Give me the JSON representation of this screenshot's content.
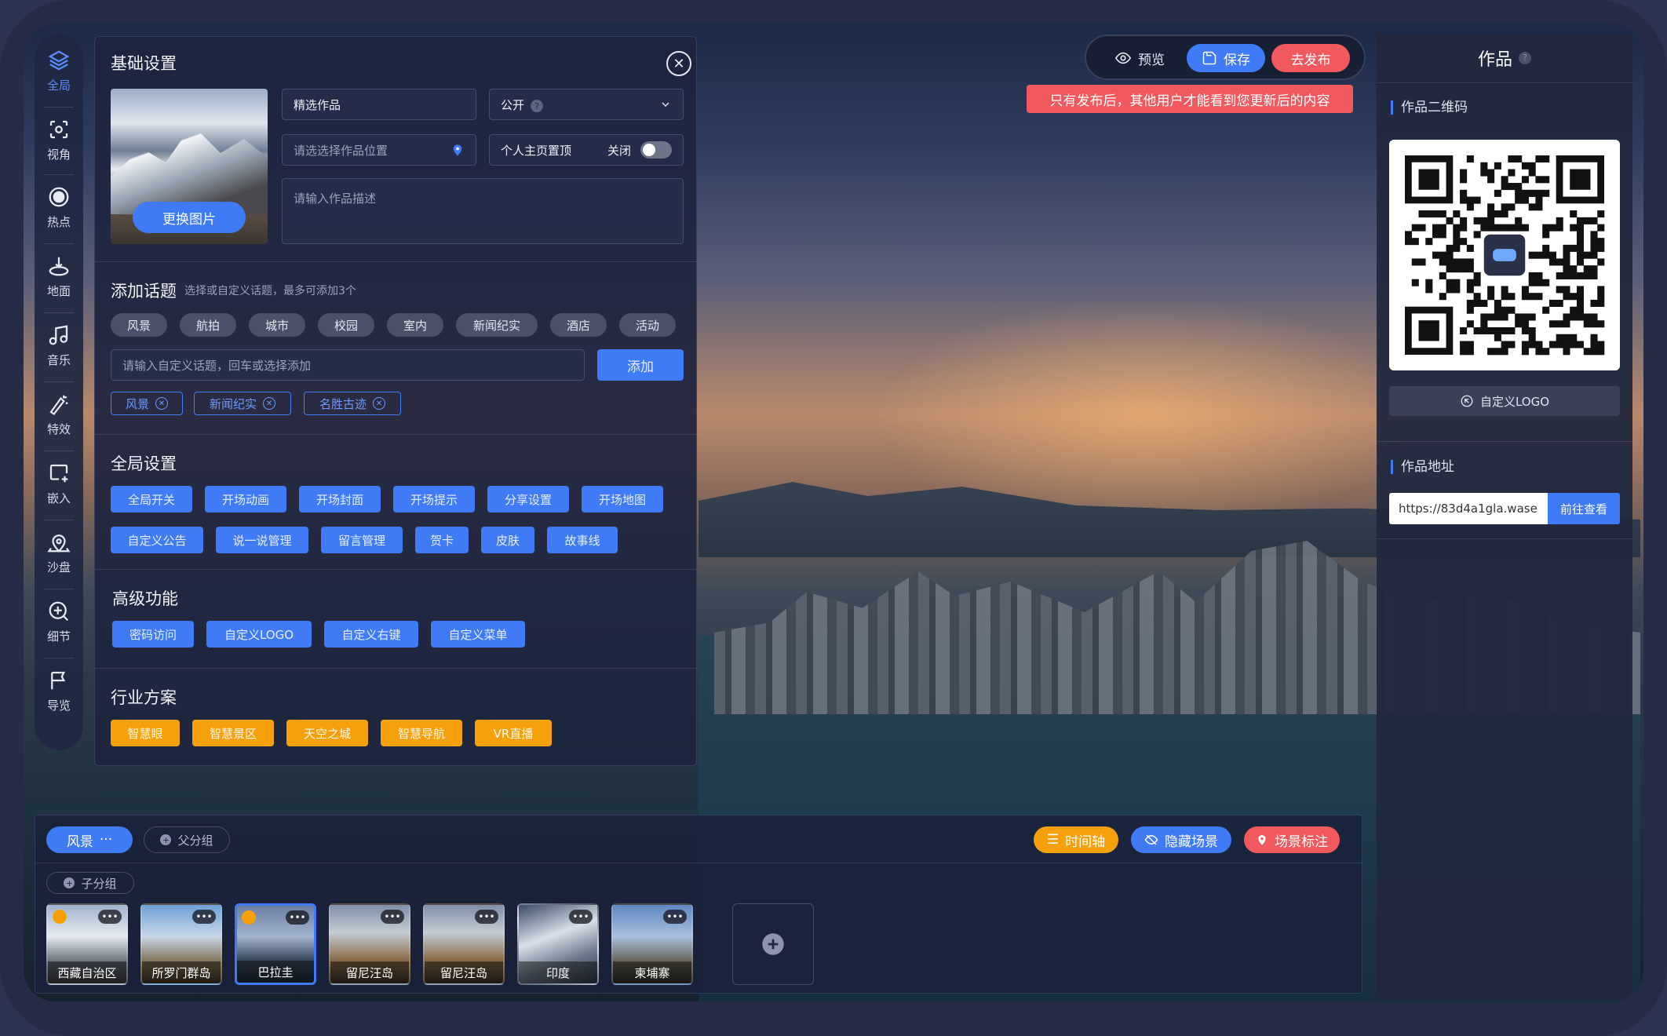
{
  "sidebar": {
    "items": [
      {
        "label": "全局",
        "icon": "layers-icon"
      },
      {
        "label": "视角",
        "icon": "view-angle-icon"
      },
      {
        "label": "热点",
        "icon": "hotspot-icon"
      },
      {
        "label": "地面",
        "icon": "ground-icon"
      },
      {
        "label": "音乐",
        "icon": "music-icon"
      },
      {
        "label": "特效",
        "icon": "effects-icon"
      },
      {
        "label": "嵌入",
        "icon": "embed-icon"
      },
      {
        "label": "沙盘",
        "icon": "sandbox-icon"
      },
      {
        "label": "细节",
        "icon": "zoom-detail-icon"
      },
      {
        "label": "导览",
        "icon": "tour-flag-icon"
      }
    ]
  },
  "basic": {
    "title": "基础设置",
    "change_image": "更换图片",
    "name_value": "精选作品",
    "visibility": "公开",
    "location_placeholder": "请选选择作品位置",
    "pin_label": "个人主页置顶",
    "pin_state": "关闭",
    "desc_placeholder": "请输入作品描述"
  },
  "topics": {
    "title": "添加话题",
    "hint": "选择或自定义话题，最多可添加3个",
    "chips": [
      "风景",
      "航拍",
      "城市",
      "校园",
      "室内",
      "新闻纪实",
      "酒店",
      "活动"
    ],
    "input_placeholder": "请输入自定义话题，回车或选择添加",
    "add_label": "添加",
    "selected": [
      "风景",
      "新闻纪实",
      "名胜古迹"
    ]
  },
  "global": {
    "title": "全局设置",
    "row1": [
      "全局开关",
      "开场动画",
      "开场封面",
      "开场提示",
      "分享设置",
      "开场地图"
    ],
    "row2": [
      "自定义公告",
      "说一说管理",
      "留言管理",
      "贺卡",
      "皮肤",
      "故事线"
    ]
  },
  "advanced": {
    "title": "高级功能",
    "items": [
      "密码访问",
      "自定义LOGO",
      "自定义右键",
      "自定义菜单"
    ]
  },
  "industry": {
    "title": "行业方案",
    "items": [
      "智慧眼",
      "智慧景区",
      "天空之城",
      "智慧导航",
      "VR直播"
    ]
  },
  "toolbar": {
    "preview": "预览",
    "save": "保存",
    "publish": "去发布",
    "notice": "只有发布后，其他用户才能看到您更新后的内容"
  },
  "right": {
    "title": "作品",
    "qr_label": "作品二维码",
    "custom_logo": "自定义LOGO",
    "url_label": "作品地址",
    "url": "https://83d4a1gla.wase",
    "go_view": "前往查看"
  },
  "bottom": {
    "group": "风景",
    "group_more": "···",
    "parent_group": "父分组",
    "child_group": "子分组",
    "timeline": "时间轴",
    "hide_scene": "隐藏场景",
    "scene_mark": "场景标注",
    "scenes": [
      "西藏自治区",
      "所罗门群岛",
      "巴拉圭",
      "留尼汪岛",
      "留尼汪岛",
      "印度",
      "柬埔寨"
    ]
  },
  "colors": {
    "accent": "#3f7bf6",
    "orange": "#f6a10c",
    "red": "#f0595e"
  }
}
